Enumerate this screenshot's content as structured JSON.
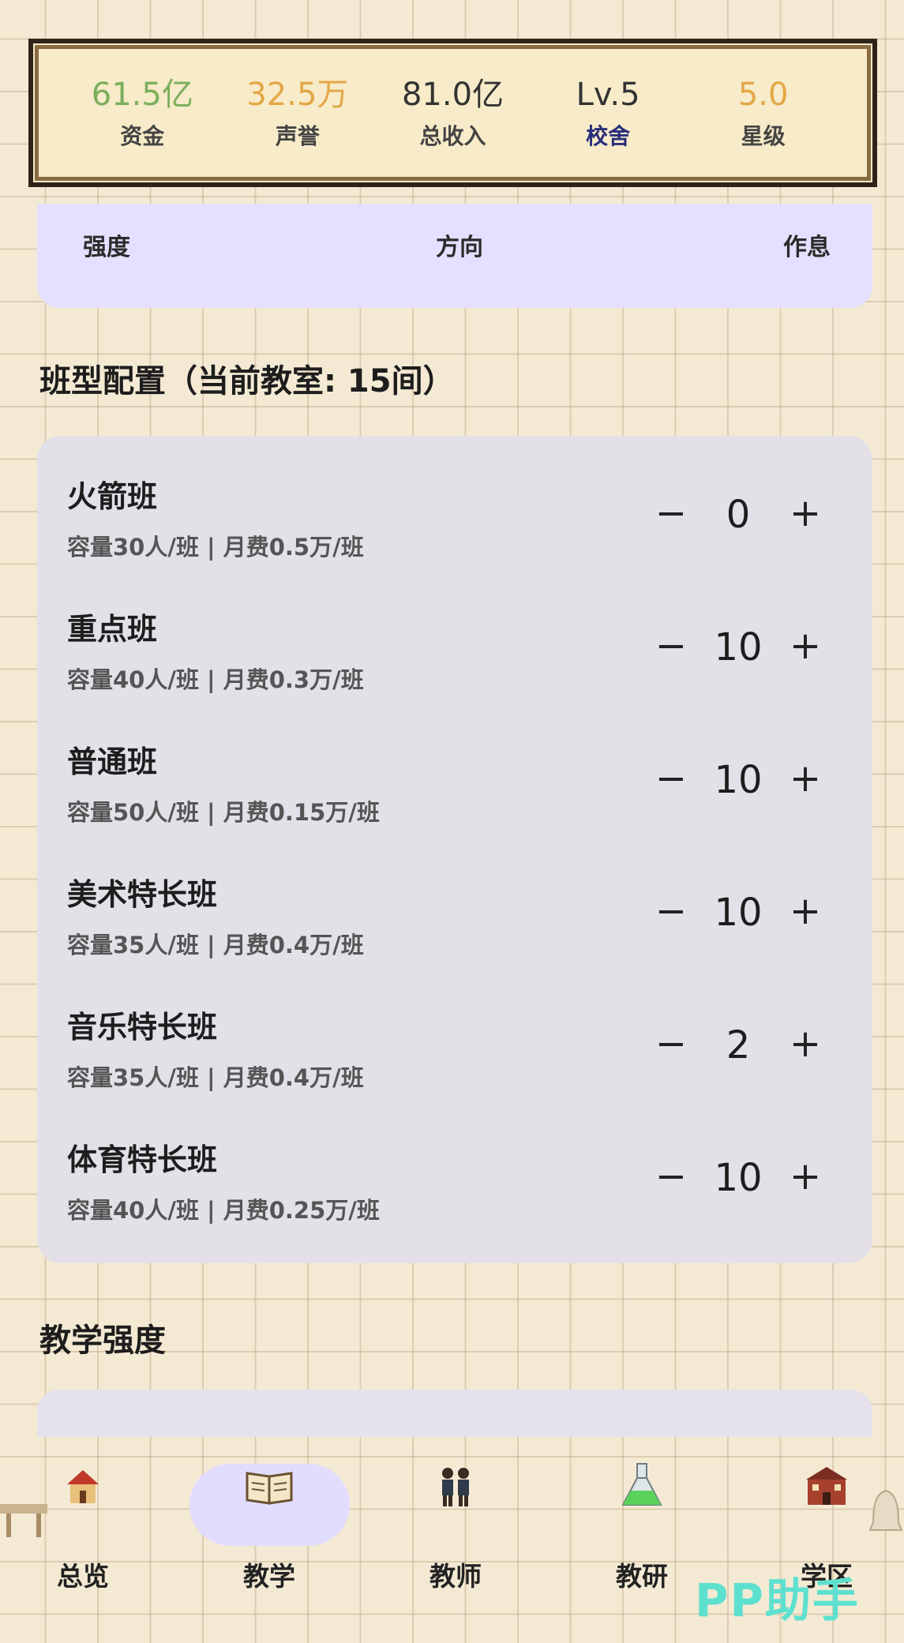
{
  "stats": [
    {
      "value": "61.5亿",
      "label": "资金",
      "value_color": "#7cae5c",
      "label_color": "#444444"
    },
    {
      "value": "32.5万",
      "label": "声誉",
      "value_color": "#e3a745",
      "label_color": "#444444"
    },
    {
      "value": "81.0亿",
      "label": "总收入",
      "value_color": "#333333",
      "label_color": "#444444"
    },
    {
      "value": "Lv.5",
      "label": "校舍",
      "value_color": "#333333",
      "label_color": "#2a2f7a"
    },
    {
      "value": "5.0",
      "label": "星级",
      "value_color": "#e3a745",
      "label_color": "#444444"
    }
  ],
  "tabs_row": {
    "strength": "强度",
    "direction": "方向",
    "rest": "作息"
  },
  "class_section_title": "班型配置（当前教室: 15间）",
  "classes": [
    {
      "name": "火箭班",
      "desc": "容量30人/班 | 月费0.5万/班",
      "count": "0"
    },
    {
      "name": "重点班",
      "desc": "容量40人/班 | 月费0.3万/班",
      "count": "10"
    },
    {
      "name": "普通班",
      "desc": "容量50人/班 | 月费0.15万/班",
      "count": "10"
    },
    {
      "name": "美术特长班",
      "desc": "容量35人/班 | 月费0.4万/班",
      "count": "10"
    },
    {
      "name": "音乐特长班",
      "desc": "容量35人/班 | 月费0.4万/班",
      "count": "2"
    },
    {
      "name": "体育特长班",
      "desc": "容量40人/班 | 月费0.25万/班",
      "count": "10"
    }
  ],
  "stepper": {
    "minus": "−",
    "plus": "+"
  },
  "strength_section_title": "教学强度",
  "nav": [
    {
      "label": "总览",
      "icon": "house-icon"
    },
    {
      "label": "教学",
      "icon": "book-icon",
      "active": true
    },
    {
      "label": "教师",
      "icon": "teachers-icon"
    },
    {
      "label": "教研",
      "icon": "flask-icon"
    },
    {
      "label": "学区",
      "icon": "school-building-icon"
    }
  ],
  "watermark": "PP助手"
}
